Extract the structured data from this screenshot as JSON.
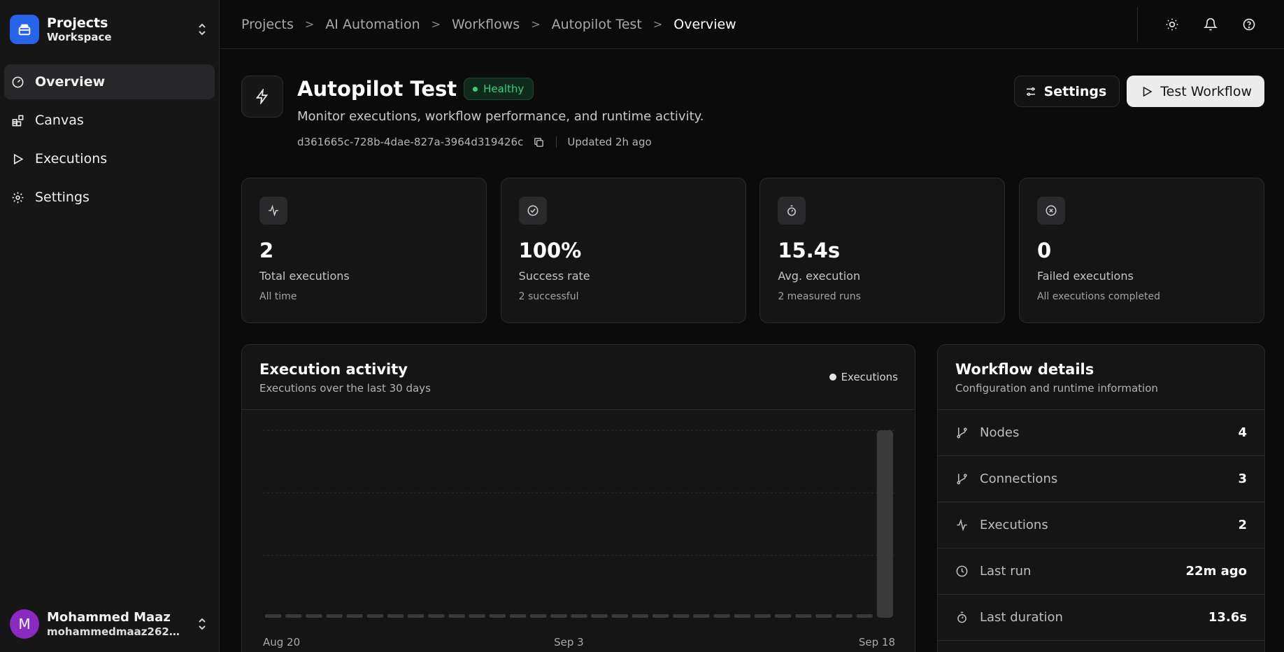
{
  "workspace": {
    "title": "Projects",
    "subtitle": "Workspace"
  },
  "nav": [
    {
      "label": "Overview",
      "icon": "gauge-icon",
      "active": true
    },
    {
      "label": "Canvas",
      "icon": "blocks-icon",
      "active": false
    },
    {
      "label": "Executions",
      "icon": "play-icon",
      "active": false
    },
    {
      "label": "Settings",
      "icon": "gear-icon",
      "active": false
    }
  ],
  "user": {
    "initial": "M",
    "name": "Mohammed Maaz",
    "email": "mohammedmaaz2623@..."
  },
  "breadcrumb": [
    "Projects",
    "AI Automation",
    "Workflows",
    "Autopilot Test",
    "Overview"
  ],
  "workflow": {
    "title": "Autopilot Test",
    "status": "Healthy",
    "description": "Monitor executions, workflow performance, and runtime activity.",
    "id": "d361665c-728b-4dae-827a-3964d319426c",
    "updated": "Updated 2h ago"
  },
  "actions": {
    "settings": "Settings",
    "test": "Test Workflow"
  },
  "stats": [
    {
      "value": "2",
      "label": "Total executions",
      "sub": "All time",
      "icon": "activity-icon"
    },
    {
      "value": "100%",
      "label": "Success rate",
      "sub": "2 successful",
      "icon": "check-circle-icon"
    },
    {
      "value": "15.4s",
      "label": "Avg. execution",
      "sub": "2 measured runs",
      "icon": "stopwatch-icon"
    },
    {
      "value": "0",
      "label": "Failed executions",
      "sub": "All executions completed",
      "icon": "x-circle-icon"
    }
  ],
  "activity": {
    "title": "Execution activity",
    "subtitle": "Executions over the last 30 days",
    "legend": "Executions"
  },
  "chart_data": {
    "type": "bar",
    "x_ticks": [
      "Aug 20",
      "Sep 3",
      "Sep 18"
    ],
    "values": [
      0,
      0,
      0,
      0,
      0,
      0,
      0,
      0,
      0,
      0,
      0,
      0,
      0,
      0,
      0,
      0,
      0,
      0,
      0,
      0,
      0,
      0,
      0,
      0,
      0,
      0,
      0,
      0,
      0,
      0,
      2
    ],
    "ylim": [
      0,
      2
    ],
    "grid": true,
    "legend": "top-right",
    "colors": {
      "bar": "#3a3a3d",
      "grid": "#2e2e31"
    }
  },
  "details": {
    "title": "Workflow details",
    "subtitle": "Configuration and runtime information",
    "rows": [
      {
        "label": "Nodes",
        "value": "4",
        "icon": "branch-icon"
      },
      {
        "label": "Connections",
        "value": "3",
        "icon": "branch-icon"
      },
      {
        "label": "Executions",
        "value": "2",
        "icon": "activity-icon"
      },
      {
        "label": "Last run",
        "value": "22m ago",
        "icon": "clock-icon"
      },
      {
        "label": "Last duration",
        "value": "13.6s",
        "icon": "stopwatch-icon"
      }
    ]
  },
  "colors": {
    "accent": "#2764ea",
    "healthy": "#33d17a",
    "avatar": "#8a2ac0"
  }
}
